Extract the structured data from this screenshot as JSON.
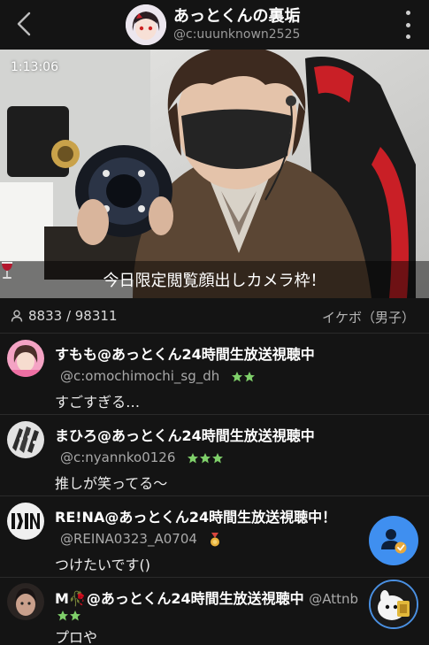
{
  "header": {
    "host_name": "あっとくんの裏垢",
    "host_id": "@c:uuunknown2525"
  },
  "video": {
    "elapsed": "1:13:06",
    "caption_emoji": "wine-glass",
    "caption": "今日限定閲覧顔出しカメラ枠！"
  },
  "stats": {
    "viewers": "8833 / 98311",
    "category": "イケボ（男子）"
  },
  "comments": [
    {
      "name": "すもも@あっとくん24時間生放送視聴中",
      "id": "@c:omochimochi_sg_dh",
      "badge": "two-green-stars",
      "text": "すごすぎる…"
    },
    {
      "name": "まひろ@あっとくん24時間生放送視聴中",
      "id": "@c:nyannko0126",
      "badge": "three-green-stars",
      "text": "推しが笑ってる〜"
    },
    {
      "name": "RE!NA@あっとくん24時間生放送視聴中！",
      "id": "@REINA0323_A0704",
      "badge": "gold-medal",
      "text": "つけたいです()"
    },
    {
      "name": "M🥀@あっとくん24時間生放送視聴中",
      "id": "@Attnb",
      "badge": "two-green-stars",
      "text": "プロや"
    }
  ],
  "colors": {
    "background": "#141414",
    "follow_button": "#3f8ff0",
    "badge_green": "#7fd06a",
    "badge_gold": "#e9b23c"
  }
}
